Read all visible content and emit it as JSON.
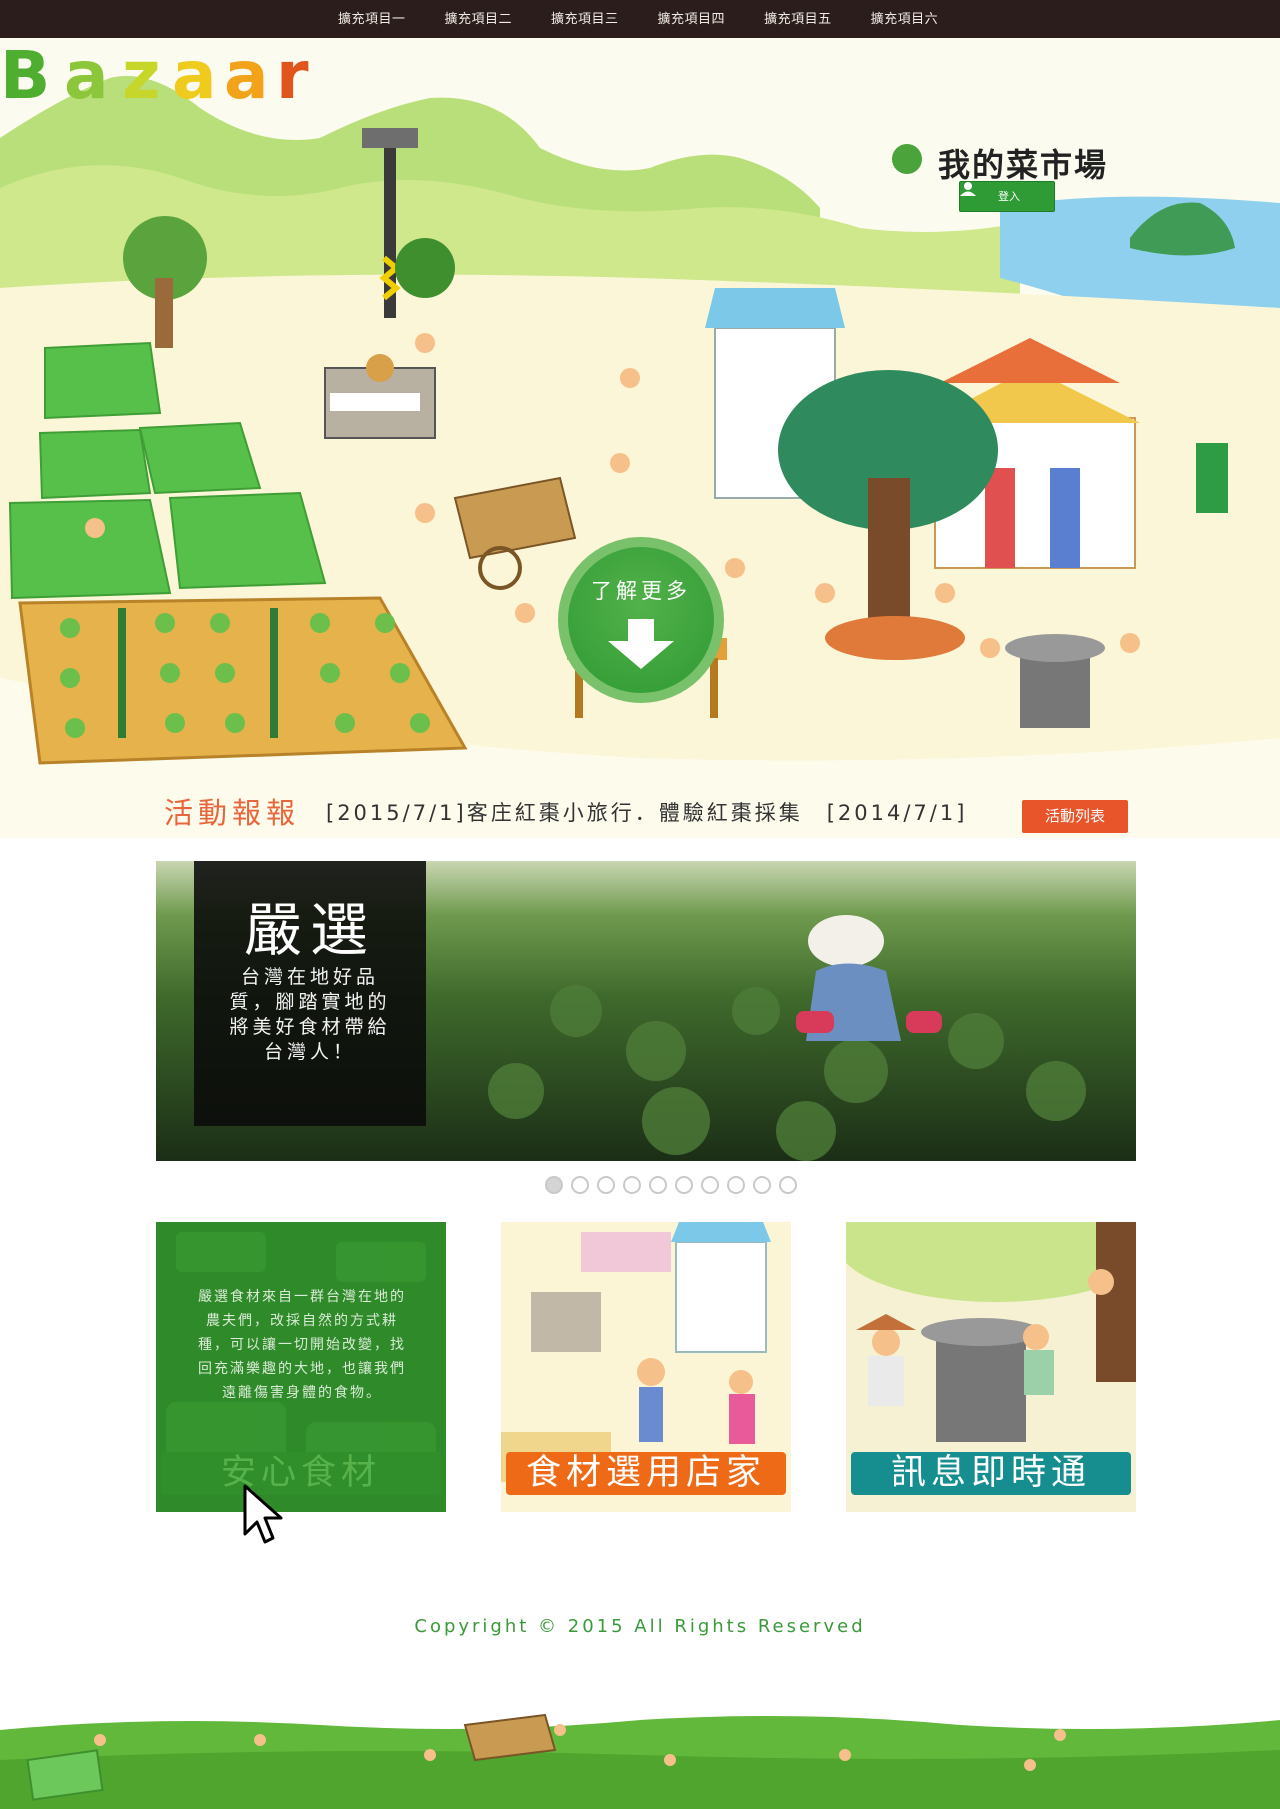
{
  "nav": {
    "items": [
      "擴充項目一",
      "擴充項目二",
      "擴充項目三",
      "擴充項目四",
      "擴充項目五",
      "擴充項目六"
    ]
  },
  "brand": {
    "logo_text": "Bazaar",
    "subtitle": "我的菜市場",
    "login_label": "登入"
  },
  "hero": {
    "more_label": "了解更多"
  },
  "news": {
    "title": "活動報報",
    "ticker": "[2015/7/1]客庄紅棗小旅行．體驗紅棗採集　[2014/7/1]",
    "list_button": "活動列表"
  },
  "slider": {
    "caption_title": "嚴選",
    "caption_text": "台灣在地好品質，腳踏實地的將美好食材帶給台灣人！",
    "dot_count": 10,
    "active_dot": 0
  },
  "cards": [
    {
      "label": "安心食材",
      "text": "嚴選食材來自一群台灣在地的農夫們，改採自然的方式耕種，可以讓一切開始改變，找回充滿樂趣的大地，也讓我們遠離傷害身體的食物。",
      "color": "#318f2b"
    },
    {
      "label": "食材選用店家",
      "color": "#ef6a16"
    },
    {
      "label": "訊息即時通",
      "color": "#168e90"
    }
  ],
  "footer": {
    "copyright": "Copyright © 2015 All Rights Reserved"
  },
  "colors": {
    "topbar": "#2a1d1b",
    "accent_green": "#2e9b35",
    "accent_orange": "#e8552a",
    "copyright_green": "#3a9a3a"
  }
}
